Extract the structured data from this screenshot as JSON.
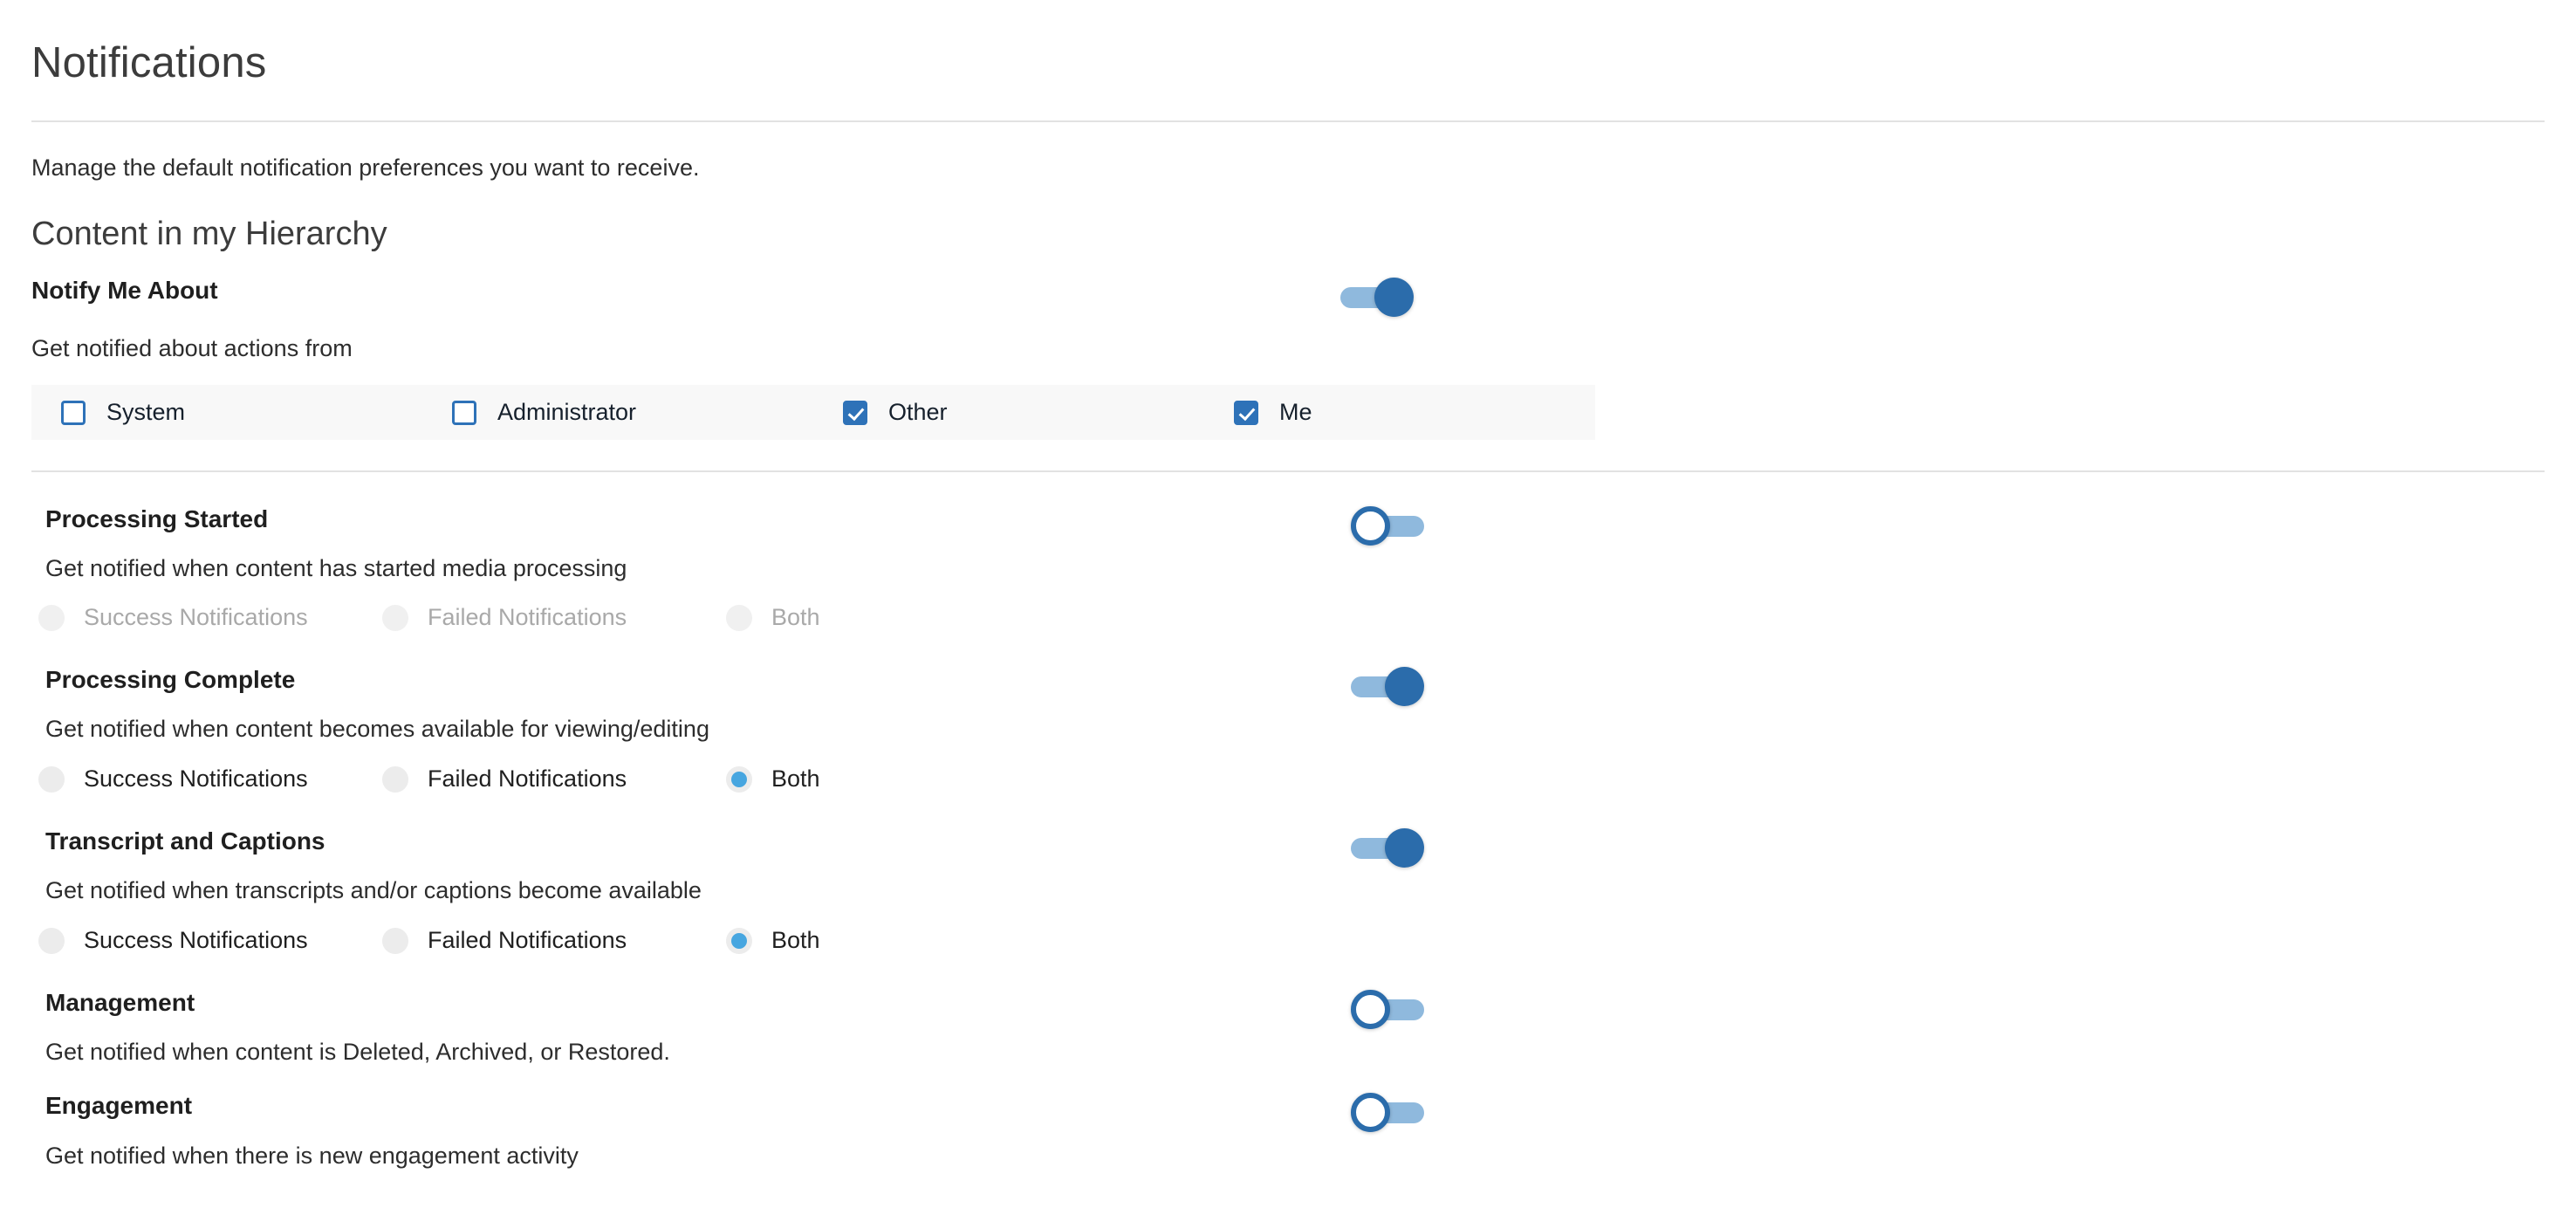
{
  "header": {
    "title": "Notifications",
    "subtitle": "Manage the default notification preferences you want to receive."
  },
  "section": {
    "heading": "Content in my Hierarchy"
  },
  "notify_me_about": {
    "title": "Notify Me About",
    "description": "Get notified about actions from",
    "toggle_state": "on",
    "sources": [
      {
        "label": "System",
        "checked": false
      },
      {
        "label": "Administrator",
        "checked": false
      },
      {
        "label": "Other",
        "checked": true
      },
      {
        "label": "Me",
        "checked": true
      }
    ]
  },
  "preferences": [
    {
      "title": "Processing Started",
      "description": "Get notified when content has started media processing",
      "toggle_state": "off",
      "radios": [
        {
          "label": "Success Notifications",
          "selected": false,
          "disabled": true
        },
        {
          "label": "Failed Notifications",
          "selected": false,
          "disabled": true
        },
        {
          "label": "Both",
          "selected": false,
          "disabled": true
        }
      ]
    },
    {
      "title": "Processing Complete",
      "description": "Get notified when content becomes available for viewing/editing",
      "toggle_state": "on",
      "radios": [
        {
          "label": "Success Notifications",
          "selected": false,
          "disabled": false
        },
        {
          "label": "Failed Notifications",
          "selected": false,
          "disabled": false
        },
        {
          "label": "Both",
          "selected": true,
          "disabled": false
        }
      ]
    },
    {
      "title": "Transcript and Captions",
      "description": "Get notified when transcripts and/or captions become available",
      "toggle_state": "on",
      "radios": [
        {
          "label": "Success Notifications",
          "selected": false,
          "disabled": false
        },
        {
          "label": "Failed Notifications",
          "selected": false,
          "disabled": false
        },
        {
          "label": "Both",
          "selected": true,
          "disabled": false
        }
      ]
    },
    {
      "title": "Management",
      "description": "Get notified when content is Deleted, Archived, or Restored.",
      "toggle_state": "off",
      "radios": []
    },
    {
      "title": "Engagement",
      "description": "Get notified when there is new engagement activity",
      "toggle_state": "off",
      "radios": []
    }
  ],
  "colors": {
    "accent_blue": "#2e72b8",
    "toggle_track": "#8fb9dd",
    "toggle_thumb_on": "#2b6cab",
    "radio_selected": "#47a6e0",
    "band_background": "#f8f8f8",
    "rule": "#e2e2e2",
    "text_primary": "#1f1f1f",
    "text_muted": "#a9a9a9"
  }
}
